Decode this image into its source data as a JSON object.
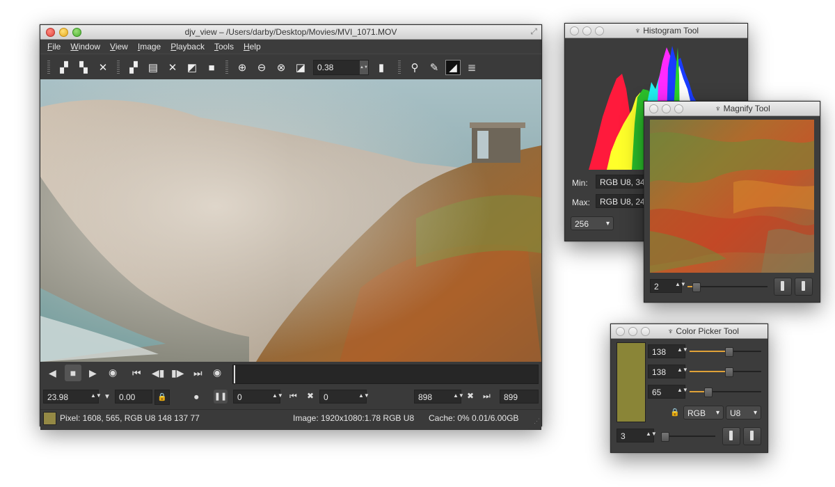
{
  "main_window": {
    "title": "djv_view – /Users/darby/Desktop/Movies/MVI_1071.MOV",
    "menu": [
      "File",
      "Window",
      "View",
      "Image",
      "Playback",
      "Tools",
      "Help"
    ],
    "zoom_value": "0.38",
    "playback": {
      "speed": "23.98",
      "fps_actual": "0.00",
      "frame_current": "0",
      "in_point": "0",
      "out_point": "898",
      "end_frame": "899"
    },
    "status": {
      "pixel": "Pixel: 1608, 565, RGB U8 148 137 77",
      "image": "Image: 1920x1080:1.78 RGB U8",
      "cache": "Cache: 0% 0.01/6.00GB",
      "pixel_swatch_color": "#948945"
    }
  },
  "histogram_tool": {
    "title": "Histogram Tool",
    "min_label": "Min:",
    "min_value": "RGB U8, 34",
    "max_label": "Max:",
    "max_value": "RGB U8, 24",
    "bins": "256"
  },
  "magnify_tool": {
    "title": "Magnify Tool",
    "zoom": "2",
    "zoom_fraction": 0.1
  },
  "color_picker_tool": {
    "title": "Color Picker Tool",
    "swatch_color": "#8a8537",
    "r": "138",
    "g": "138",
    "b": "65",
    "r_fraction": 0.54,
    "g_fraction": 0.54,
    "b_fraction": 0.25,
    "format": "RGB",
    "type": "U8",
    "sample_size": "3"
  }
}
